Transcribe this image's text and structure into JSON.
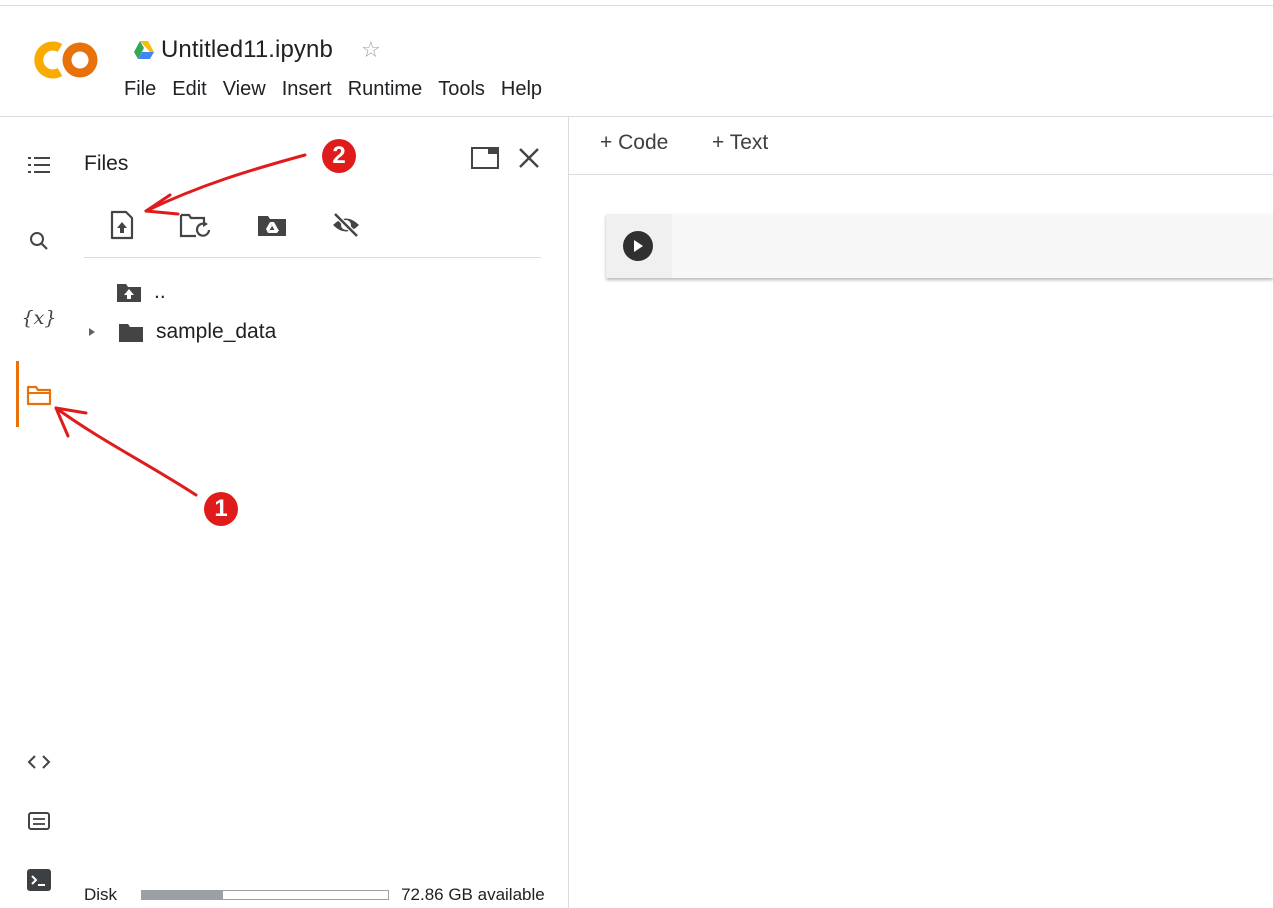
{
  "header": {
    "logo_text": "CO",
    "doc_title": "Untitled11.ipynb",
    "star_icon": "star-outline-icon",
    "drive_icon": "google-drive-icon"
  },
  "menu": [
    "File",
    "Edit",
    "View",
    "Insert",
    "Runtime",
    "Tools",
    "Help"
  ],
  "rail": {
    "items": [
      {
        "icon": "table-of-contents-icon"
      },
      {
        "icon": "search-icon"
      },
      {
        "icon": "variables-icon",
        "label": "{x}"
      },
      {
        "icon": "folder-icon",
        "active": true
      },
      {
        "icon": "code-snippets-icon"
      },
      {
        "icon": "command-palette-icon"
      },
      {
        "icon": "terminal-icon"
      }
    ]
  },
  "files_panel": {
    "title": "Files",
    "toolbar": [
      "upload-file-icon",
      "refresh-folder-icon",
      "mount-drive-icon",
      "hide-files-icon"
    ],
    "tree": [
      {
        "label": "..",
        "icon": "parent-folder-icon"
      },
      {
        "label": "sample_data",
        "icon": "folder-icon"
      }
    ],
    "disk": {
      "label": "Disk",
      "used_fraction": 0.33,
      "available": "72.86 GB available"
    }
  },
  "notebook": {
    "add_code_label": "+ Code",
    "add_text_label": "+ Text"
  },
  "annotations": {
    "badge_1": "1",
    "badge_2": "2",
    "accent_color": "#e01b1b"
  },
  "colors": {
    "accent_orange": "#e8710a",
    "logo_yellow": "#f9ab00"
  }
}
